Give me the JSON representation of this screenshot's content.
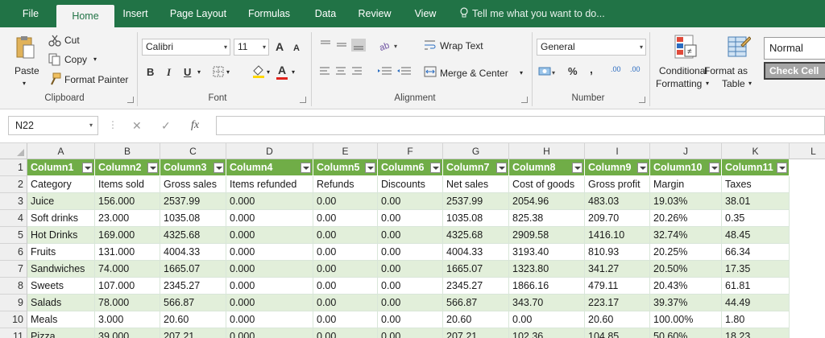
{
  "tabs": [
    "File",
    "Home",
    "Insert",
    "Page Layout",
    "Formulas",
    "Data",
    "Review",
    "View"
  ],
  "active_tab": "Home",
  "tell_me": "Tell me what you want to do...",
  "ribbon": {
    "clipboard": {
      "paste": "Paste",
      "cut": "Cut",
      "copy": "Copy",
      "format_painter": "Format Painter",
      "label": "Clipboard"
    },
    "font": {
      "name": "Calibri",
      "size": "11",
      "bold": "B",
      "italic": "I",
      "underline": "U",
      "grow": "A",
      "shrink": "A",
      "color_letter": "A",
      "label": "Font"
    },
    "alignment": {
      "wrap_text": "Wrap Text",
      "merge_center": "Merge & Center",
      "label": "Alignment"
    },
    "number": {
      "format": "General",
      "percent": "%",
      "comma": ",",
      "inc_decimal": ".00",
      "dec_decimal": ".00",
      "label": "Number"
    },
    "styles": {
      "conditional_1": "Conditional",
      "conditional_2": "Formatting",
      "format_as_1": "Format as",
      "format_as_2": "Table",
      "normal": "Normal",
      "check_cell": "Check Cell"
    }
  },
  "formula_bar": {
    "name_box": "N22",
    "fx": "fx",
    "cancel": "✕",
    "enter": "✓",
    "value": ""
  },
  "columns": [
    "A",
    "B",
    "C",
    "D",
    "E",
    "F",
    "G",
    "H",
    "I",
    "J",
    "K",
    "L"
  ],
  "rows": [
    {
      "num": "1",
      "cells": [
        "Column1",
        "Column2",
        "Column3",
        "Column4",
        "Column5",
        "Column6",
        "Column7",
        "Column8",
        "Column9",
        "Column10",
        "Column11"
      ]
    },
    {
      "num": "2",
      "cells": [
        "Category",
        "Items sold",
        "Gross sales",
        "Items refunded",
        "Refunds",
        "Discounts",
        "Net sales",
        "Cost of goods",
        "Gross profit",
        "Margin",
        "Taxes"
      ]
    },
    {
      "num": "3",
      "cells": [
        "Juice",
        "156.000",
        "2537.99",
        "0.000",
        "0.00",
        "0.00",
        "2537.99",
        "2054.96",
        "483.03",
        "19.03%",
        "38.01"
      ]
    },
    {
      "num": "4",
      "cells": [
        "Soft drinks",
        "23.000",
        "1035.08",
        "0.000",
        "0.00",
        "0.00",
        "1035.08",
        "825.38",
        "209.70",
        "20.26%",
        "0.35"
      ]
    },
    {
      "num": "5",
      "cells": [
        "Hot Drinks",
        "169.000",
        "4325.68",
        "0.000",
        "0.00",
        "0.00",
        "4325.68",
        "2909.58",
        "1416.10",
        "32.74%",
        "48.45"
      ]
    },
    {
      "num": "6",
      "cells": [
        "Fruits",
        "131.000",
        "4004.33",
        "0.000",
        "0.00",
        "0.00",
        "4004.33",
        "3193.40",
        "810.93",
        "20.25%",
        "66.34"
      ]
    },
    {
      "num": "7",
      "cells": [
        "Sandwiches",
        "74.000",
        "1665.07",
        "0.000",
        "0.00",
        "0.00",
        "1665.07",
        "1323.80",
        "341.27",
        "20.50%",
        "17.35"
      ]
    },
    {
      "num": "8",
      "cells": [
        "Sweets",
        "107.000",
        "2345.27",
        "0.000",
        "0.00",
        "0.00",
        "2345.27",
        "1866.16",
        "479.11",
        "20.43%",
        "61.81"
      ]
    },
    {
      "num": "9",
      "cells": [
        "Salads",
        "78.000",
        "566.87",
        "0.000",
        "0.00",
        "0.00",
        "566.87",
        "343.70",
        "223.17",
        "39.37%",
        "44.49"
      ]
    },
    {
      "num": "10",
      "cells": [
        "Meals",
        "3.000",
        "20.60",
        "0.000",
        "0.00",
        "0.00",
        "20.60",
        "0.00",
        "20.60",
        "100.00%",
        "1.80"
      ]
    },
    {
      "num": "11",
      "cells": [
        "Pizza",
        "39.000",
        "207.21",
        "0.000",
        "0.00",
        "0.00",
        "207.21",
        "102.36",
        "104.85",
        "50.60%",
        "18.23"
      ]
    }
  ],
  "colors": {
    "accent": "#217346",
    "table_header": "#70ad47",
    "band": "#e2efda"
  }
}
